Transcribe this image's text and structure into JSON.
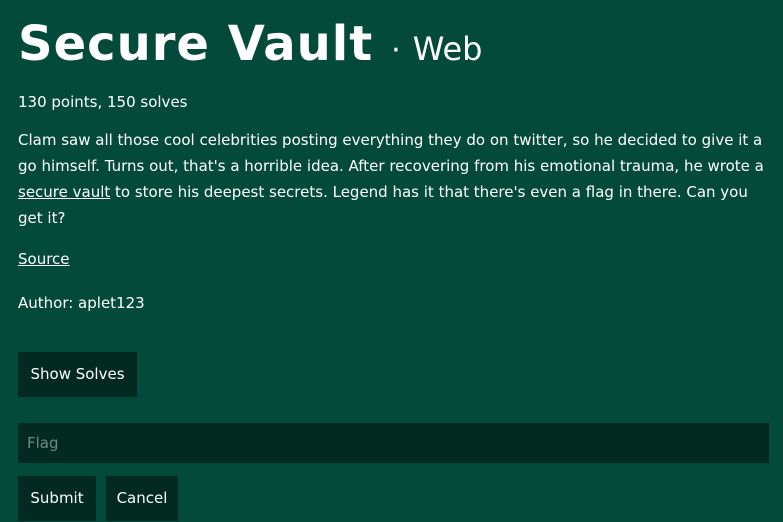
{
  "challenge": {
    "title": "Secure Vault",
    "separator": "·",
    "category": "Web",
    "meta": "130 points, 150 solves",
    "description": {
      "part1": "Clam saw all those cool celebrities posting everything they do on twitter, so he decided to give it a go himself. Turns out, that's a horrible idea. After recovering from his emotional trauma, he wrote a ",
      "link_text": "secure vault",
      "part2": " to store his deepest secrets. Legend has it that there's even a flag in there. Can you get it?"
    },
    "source_link": "Source",
    "author": "Author: aplet123"
  },
  "buttons": {
    "show_solves": "Show Solves",
    "submit": "Submit",
    "cancel": "Cancel"
  },
  "flag_input": {
    "placeholder": "Flag",
    "value": ""
  },
  "colors": {
    "background": "#034a3b",
    "control_background": "#022a21",
    "text": "#ffffff",
    "placeholder": "#6f8a83"
  }
}
